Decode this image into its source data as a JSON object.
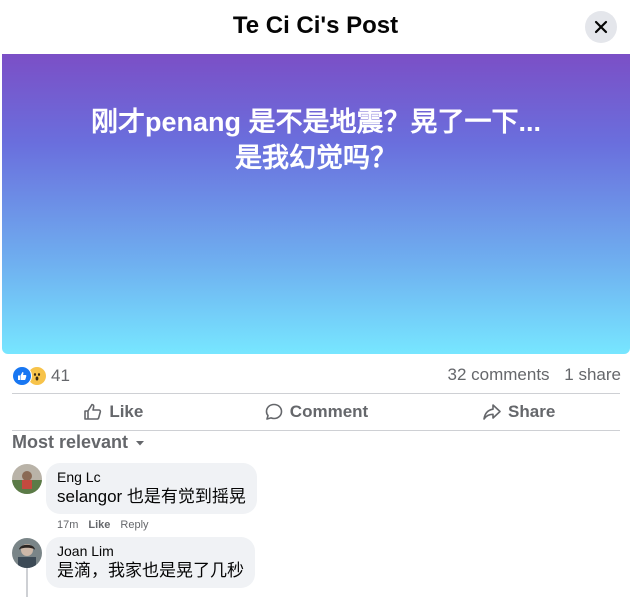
{
  "dialog": {
    "title": "Te Ci Ci's Post"
  },
  "post": {
    "text_line1": "刚才penang 是不是地震？晃了一下...",
    "text_line2": "是我幻觉吗？"
  },
  "reactions": {
    "count": "41",
    "types": [
      "like",
      "wow"
    ]
  },
  "stats": {
    "comments": "32 comments",
    "shares": "1 share"
  },
  "actions": {
    "like": "Like",
    "comment": "Comment",
    "share": "Share"
  },
  "sort": {
    "label": "Most relevant"
  },
  "comments": [
    {
      "name": "Eng Lc",
      "text": "selangor 也是有觉到摇晃",
      "time": "17m",
      "like": "Like",
      "reply": "Reply"
    },
    {
      "name": "Joan Lim",
      "text": "是滴，我家也是晃了几秒"
    }
  ],
  "colors": {
    "accent": "#1877f2",
    "secondary_text": "#65676b",
    "bubble": "#f0f2f5"
  }
}
